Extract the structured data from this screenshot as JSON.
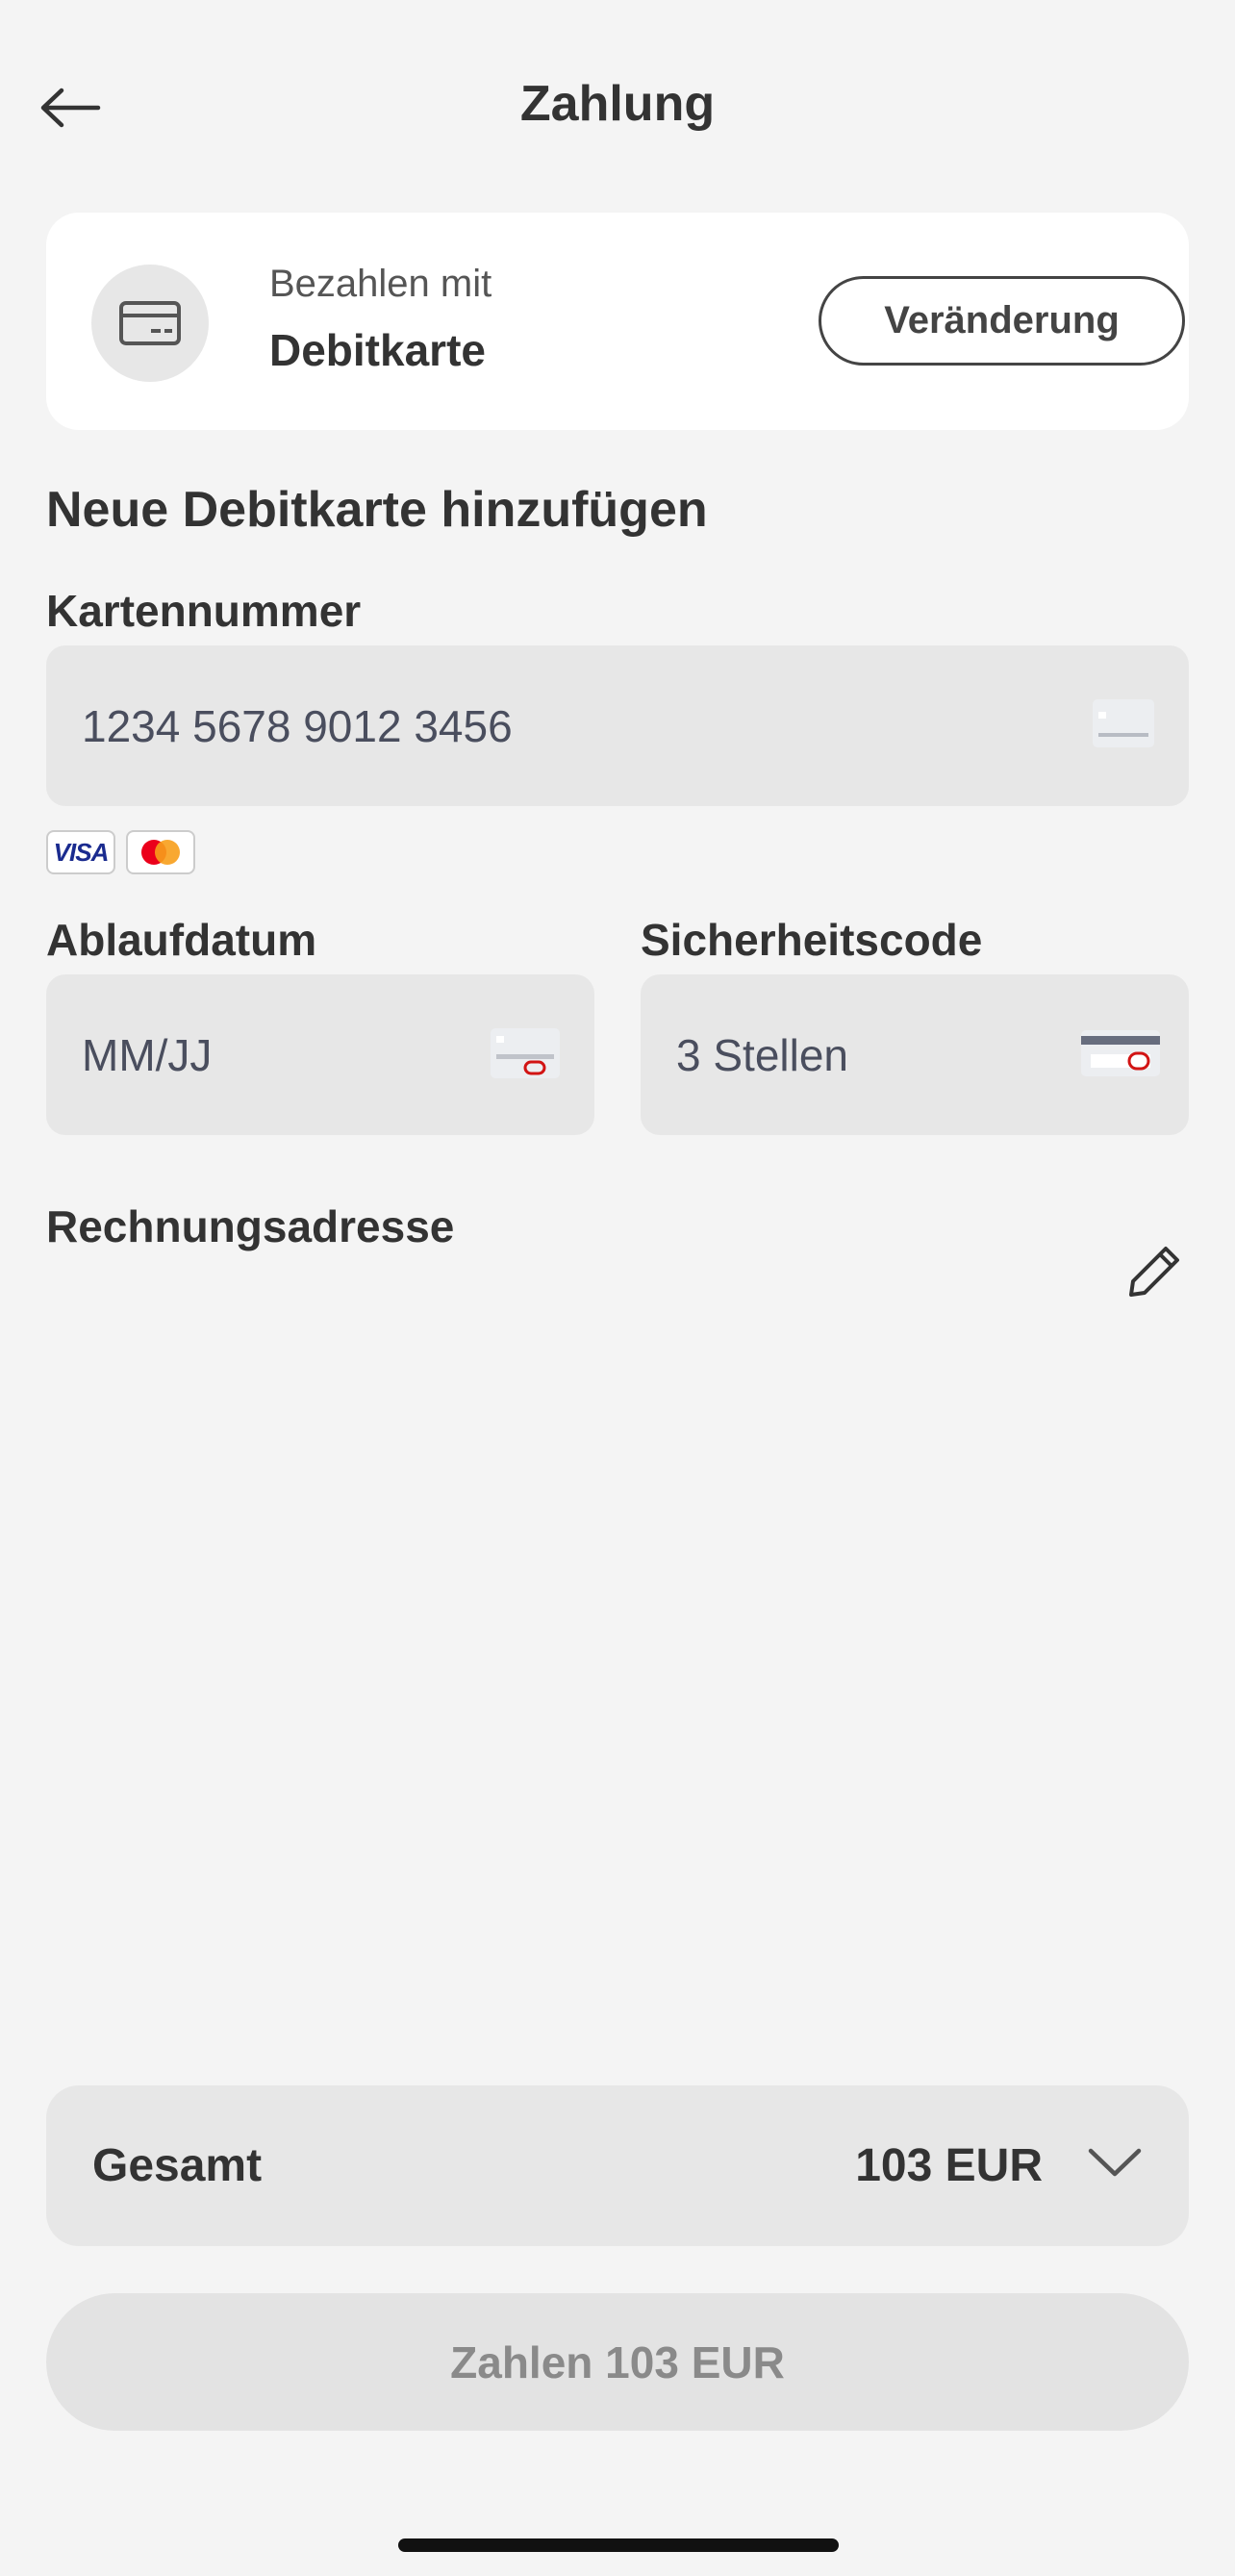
{
  "header": {
    "title": "Zahlung",
    "back_icon": "arrow-left-icon"
  },
  "payment_method": {
    "prefix": "Bezahlen mit",
    "method": "Debitkarte",
    "change_label": "Veränderung",
    "icon": "credit-card-icon"
  },
  "form": {
    "heading": "Neue Debitkarte hinzufügen",
    "card_number": {
      "label": "Kartennummer",
      "placeholder": "1234 5678 9012 3456"
    },
    "brands": [
      "VISA",
      "Mastercard"
    ],
    "expiry": {
      "label": "Ablaufdatum",
      "placeholder": "MM/JJ"
    },
    "security": {
      "label": "Sicherheitscode",
      "placeholder": "3 Stellen"
    },
    "billing": {
      "label": "Rechnungsadresse",
      "edit_icon": "pencil-icon"
    }
  },
  "total": {
    "label": "Gesamt",
    "value": "103 EUR",
    "toggle_icon": "chevron-down-icon"
  },
  "pay_button": {
    "label": "Zahlen 103 EUR"
  }
}
